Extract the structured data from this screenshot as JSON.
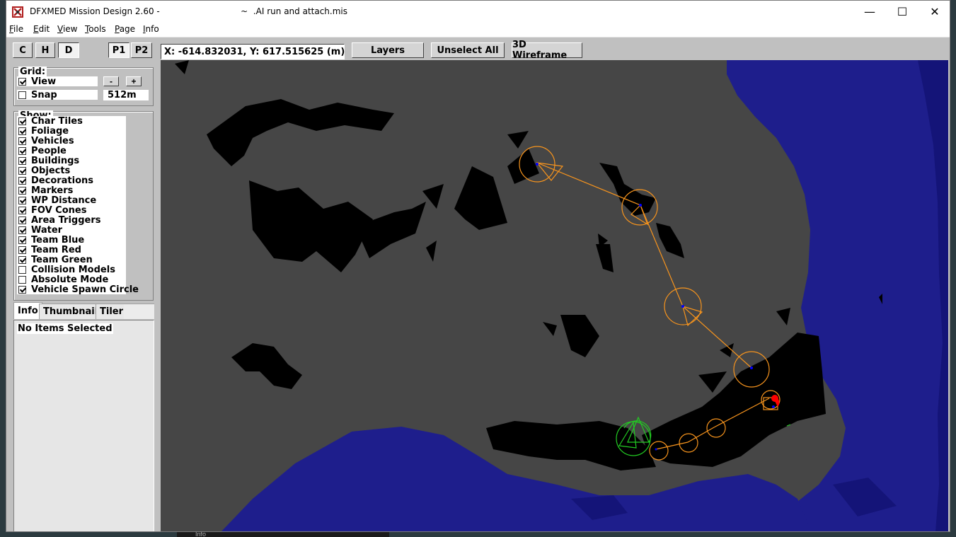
{
  "window": {
    "title": "DFXMED Mission Design 2.60 -                              ~  .AI run and attach.mis",
    "minimize_glyph": "—",
    "maximize_glyph": "☐",
    "close_glyph": "✕"
  },
  "menu": [
    "File",
    "Edit",
    "View",
    "Tools",
    "Page",
    "Info"
  ],
  "toolbar": {
    "view_buttons": [
      "C",
      "H",
      "D"
    ],
    "view_selected": "D",
    "page_buttons": [
      "P1",
      "P2"
    ],
    "page_selected": "P1",
    "coordinates": "X: -614.832031, Y: 617.515625 (m)",
    "layers_label": "Layers",
    "unselect_all_label": "Unselect All",
    "wireframe_label": "3D Wireframe"
  },
  "grid": {
    "label": "Grid:",
    "view_label": "View",
    "view_checked": true,
    "snap_label": "Snap",
    "snap_checked": false,
    "minus_label": "-",
    "plus_label": "+",
    "size_value": "512m"
  },
  "show": {
    "label": "Show:",
    "items": [
      {
        "label": "Char Tiles",
        "checked": true
      },
      {
        "label": "Foliage",
        "checked": true
      },
      {
        "label": "Vehicles",
        "checked": true
      },
      {
        "label": "People",
        "checked": true
      },
      {
        "label": "Buildings",
        "checked": true
      },
      {
        "label": "Objects",
        "checked": true
      },
      {
        "label": "Decorations",
        "checked": true
      },
      {
        "label": "Markers",
        "checked": true
      },
      {
        "label": "WP Distance",
        "checked": true
      },
      {
        "label": "FOV Cones",
        "checked": true
      },
      {
        "label": "Area Triggers",
        "checked": true
      },
      {
        "label": "Water",
        "checked": true
      },
      {
        "label": "Team Blue",
        "checked": true
      },
      {
        "label": "Team Red",
        "checked": true
      },
      {
        "label": "Team Green",
        "checked": true
      },
      {
        "label": "Collision Models",
        "checked": false
      },
      {
        "label": "Absolute Mode",
        "checked": false
      },
      {
        "label": "Vehicle Spawn Circle",
        "checked": true
      }
    ]
  },
  "tabs": {
    "items": [
      "Info",
      "Thumbnail",
      "Tiler"
    ],
    "active": "Info"
  },
  "info_panel": {
    "status": "No Items Selected"
  },
  "taskbar": {
    "label": "Info"
  },
  "colors": {
    "land": "#464646",
    "dense_terrain": "#000000",
    "water": "#1e1e8c",
    "deep_water": "#141478",
    "waypoint": "#f7941d",
    "team_green": "#22cc22",
    "team_red": "#ff0000",
    "team_blue": "#0000ff"
  },
  "icons": {
    "app": "dfx-app-icon",
    "minimize": "minimize-icon",
    "maximize": "maximize-icon",
    "close": "close-icon"
  }
}
